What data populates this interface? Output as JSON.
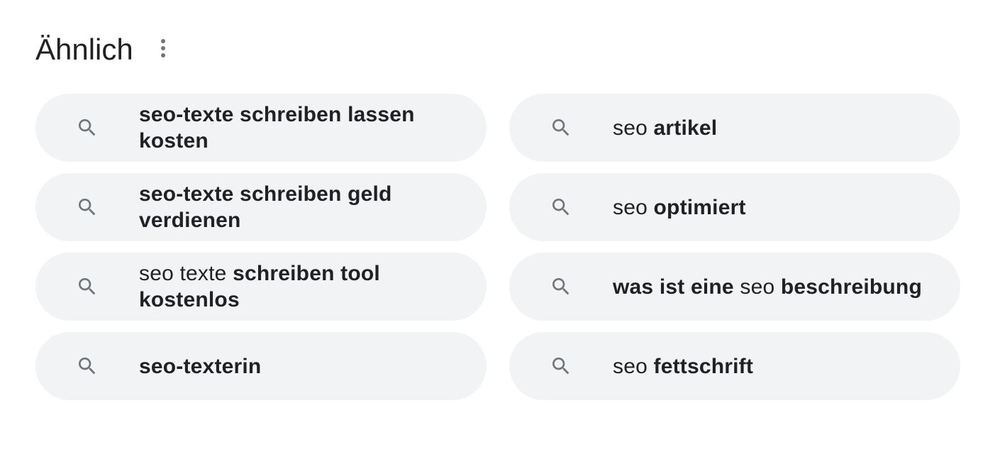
{
  "section": {
    "title": "Ähnlich",
    "more_icon": "more-vert-icon"
  },
  "suggestions": [
    {
      "icon": "search-icon",
      "parts": [
        {
          "text": "seo-texte schreiben lassen kosten",
          "bold": true
        }
      ]
    },
    {
      "icon": "search-icon",
      "parts": [
        {
          "text": "seo ",
          "bold": false
        },
        {
          "text": "artikel",
          "bold": true
        }
      ]
    },
    {
      "icon": "search-icon",
      "parts": [
        {
          "text": "seo-texte schreiben geld verdienen",
          "bold": true
        }
      ]
    },
    {
      "icon": "search-icon",
      "parts": [
        {
          "text": "seo ",
          "bold": false
        },
        {
          "text": "optimiert",
          "bold": true
        }
      ]
    },
    {
      "icon": "search-icon",
      "parts": [
        {
          "text": "seo texte ",
          "bold": false
        },
        {
          "text": "schreiben tool kostenlos",
          "bold": true
        }
      ]
    },
    {
      "icon": "search-icon",
      "parts": [
        {
          "text": "was ist eine",
          "bold": true
        },
        {
          "text": " seo ",
          "bold": false
        },
        {
          "text": "beschreibung",
          "bold": true
        }
      ]
    },
    {
      "icon": "search-icon",
      "parts": [
        {
          "text": "seo-texterin",
          "bold": true
        }
      ]
    },
    {
      "icon": "search-icon",
      "parts": [
        {
          "text": "seo ",
          "bold": false
        },
        {
          "text": "fettschrift",
          "bold": true
        }
      ]
    }
  ],
  "colors": {
    "chip_background": "#f1f3f4",
    "text": "#202124",
    "icon": "#70757a"
  }
}
